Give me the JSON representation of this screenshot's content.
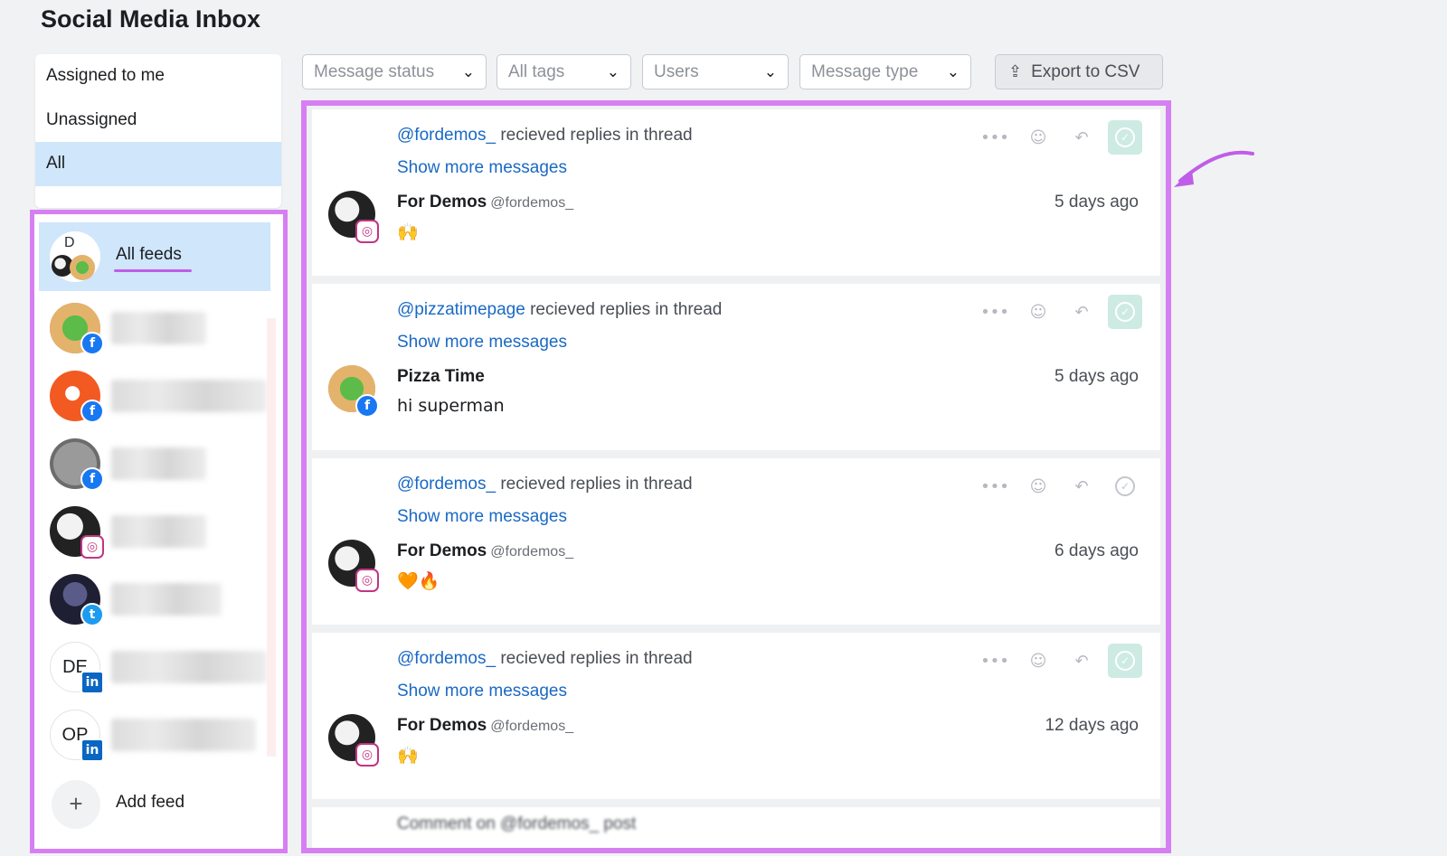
{
  "page_title": "Social Media Inbox",
  "status_menu": [
    {
      "label": "Assigned to me",
      "active": false
    },
    {
      "label": "Unassigned",
      "active": false
    },
    {
      "label": "All",
      "active": true
    }
  ],
  "feeds": {
    "all_feeds_label": "All feeds",
    "all_feeds_initial": "D",
    "items": [
      {
        "network": "facebook",
        "avatar": "pizza-logo",
        "initials": ""
      },
      {
        "network": "facebook",
        "avatar": "orange-logo",
        "initials": ""
      },
      {
        "network": "facebook",
        "avatar": "social-media-logo",
        "initials": ""
      },
      {
        "network": "instagram",
        "avatar": "portrait",
        "initials": ""
      },
      {
        "network": "twitter",
        "avatar": "person",
        "initials": ""
      },
      {
        "network": "linkedin",
        "avatar": "initials",
        "initials": "DE"
      },
      {
        "network": "linkedin",
        "avatar": "initials",
        "initials": "OP"
      }
    ],
    "add_feed_label": "Add feed",
    "add_icon": "+"
  },
  "filters": {
    "message_status": "Message status",
    "all_tags": "All tags",
    "users": "Users",
    "message_type": "Message type",
    "export_label": "Export to CSV"
  },
  "messages": [
    {
      "handle": "@fordemos_",
      "thread_text": " recieved replies in thread",
      "show_more": "Show more messages",
      "author": "For Demos",
      "author_handle": "@fordemos_",
      "time": "5 days ago",
      "text": "🙌",
      "network": "instagram",
      "avatar": "portrait",
      "resolved": true
    },
    {
      "handle": "@pizzatimepage",
      "thread_text": " recieved replies in thread",
      "show_more": "Show more messages",
      "author": "Pizza Time",
      "author_handle": "",
      "time": "5 days ago",
      "text": "hi superman",
      "network": "facebook",
      "avatar": "pizza-logo",
      "resolved": true
    },
    {
      "handle": "@fordemos_",
      "thread_text": " recieved replies in thread",
      "show_more": "Show more messages",
      "author": "For Demos",
      "author_handle": "@fordemos_",
      "time": "6 days ago",
      "text": "🧡🔥",
      "network": "instagram",
      "avatar": "portrait",
      "resolved": false
    },
    {
      "handle": "@fordemos_",
      "thread_text": " recieved replies in thread",
      "show_more": "Show more messages",
      "author": "For Demos",
      "author_handle": "@fordemos_",
      "time": "12 days ago",
      "text": "🙌",
      "network": "instagram",
      "avatar": "portrait",
      "resolved": true
    }
  ],
  "partial_message": "Comment on @fordemos_ post",
  "colors": {
    "highlight_border": "#d67ff3",
    "active_bg": "#cfe6fb",
    "link": "#1a69c4",
    "resolved_bg": "#cdebe3"
  }
}
